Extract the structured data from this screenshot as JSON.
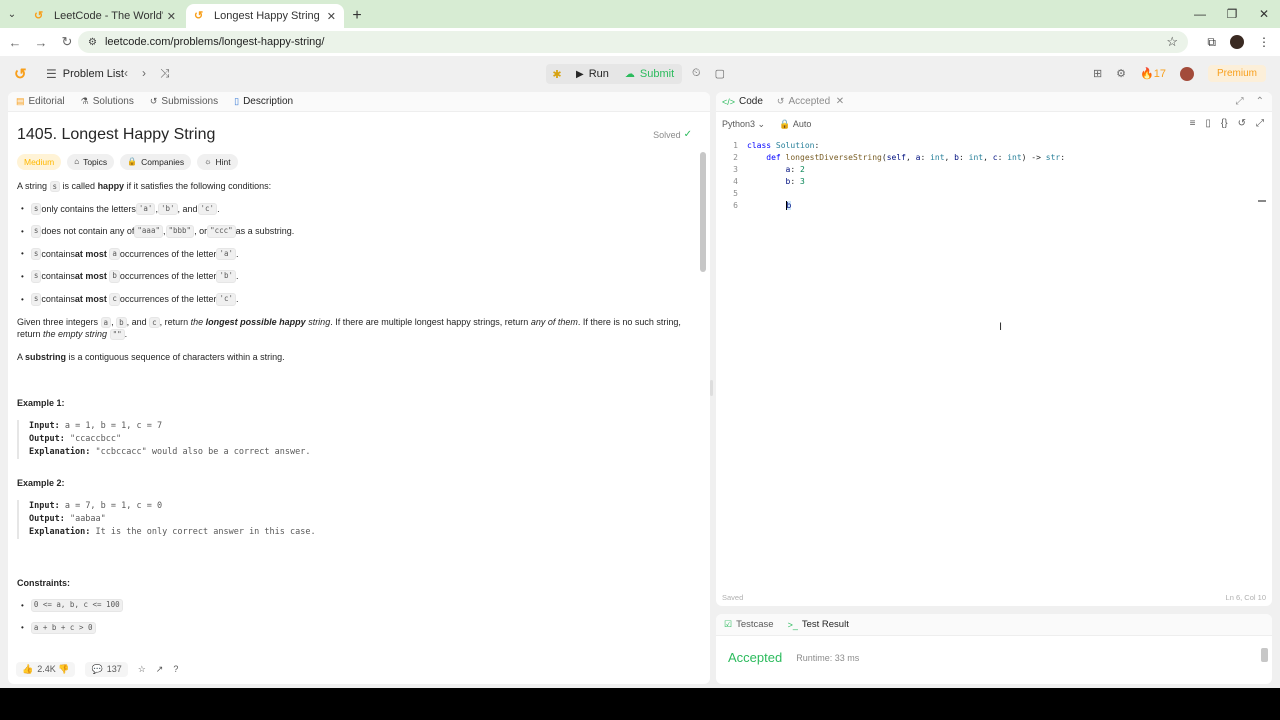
{
  "browser": {
    "tabs": [
      {
        "label": "LeetCode - The World's Leadin",
        "active": false
      },
      {
        "label": "Longest Happy String - LeetCo",
        "active": true
      }
    ],
    "url": "leetcode.com/problems/longest-happy-string/"
  },
  "topbar": {
    "problem_list": "Problem List",
    "run": "Run",
    "submit": "Submit",
    "streak": "17",
    "premium": "Premium"
  },
  "left_tabs": [
    "Editorial",
    "Solutions",
    "Submissions",
    "Description"
  ],
  "problem": {
    "title": "1405. Longest Happy String",
    "status": "Solved",
    "difficulty": "Medium",
    "chips": [
      "Topics",
      "Companies",
      "Hint"
    ],
    "intro_pre": "A string ",
    "intro_code": "s",
    "intro_mid": " is called ",
    "intro_bold": "happy",
    "intro_post": " if it satisfies the following conditions:",
    "conditions": [
      {
        "c1": "s",
        "t1": " only contains the letters ",
        "c2": "'a'",
        "t2": ", ",
        "c3": "'b'",
        "t3": ", and ",
        "c4": "'c'",
        "t4": "."
      },
      {
        "c1": "s",
        "t1": " does not contain any of ",
        "c2": "\"aaa\"",
        "t2": ", ",
        "c3": "\"bbb\"",
        "t3": ", or ",
        "c4": "\"ccc\"",
        "t4": " as a substring."
      },
      {
        "c1": "s",
        "t1": " contains ",
        "b": "at most",
        "c2": "a",
        "t2": " occurrences of the letter ",
        "c3": "'a'",
        "t3": "."
      },
      {
        "c1": "s",
        "t1": " contains ",
        "b": "at most",
        "c2": "b",
        "t2": " occurrences of the letter ",
        "c3": "'b'",
        "t3": "."
      },
      {
        "c1": "s",
        "t1": " contains ",
        "b": "at most",
        "c2": "c",
        "t2": " occurrences of the letter ",
        "c3": "'c'",
        "t3": "."
      }
    ],
    "given": {
      "p1": "Given three integers ",
      "a": "a",
      "sep1": ", ",
      "b": "b",
      "sep2": ", and ",
      "c": "c",
      "p2": ", return ",
      "i1": "the ",
      "bi": "longest possible happy",
      "i2": " string",
      "p3": ". If there are multiple longest happy strings, return ",
      "i3": "any of them",
      "p4": ". If there is no such string, return ",
      "i4": "the empty string",
      "p5": " ",
      "empty": "\"\"",
      "p6": "."
    },
    "substring_pre": "A ",
    "substring_bold": "substring",
    "substring_post": " is a contiguous sequence of characters within a string.",
    "examples": [
      {
        "title": "Example 1:",
        "input": "a = 1, b = 1, c = 7",
        "output": "\"ccaccbcc\"",
        "explanation": "\"ccbccacc\" would also be a correct answer."
      },
      {
        "title": "Example 2:",
        "input": "a = 7, b = 1, c = 0",
        "output": "\"aabaa\"",
        "explanation": "It is the only correct answer in this case."
      }
    ],
    "labels": {
      "input": "Input:",
      "output": "Output:",
      "explanation": "Explanation:"
    },
    "constraints_title": "Constraints:",
    "constraints": [
      "0 <= a, b, c <= 100",
      "a + b + c > 0"
    ]
  },
  "left_footer": {
    "likes": "2.4K",
    "comments": "137"
  },
  "code_panel": {
    "tab_code": "Code",
    "tab_accepted": "Accepted",
    "language": "Python3",
    "auto": "Auto",
    "lines": [
      {
        "n": "1",
        "code": "class Solution:"
      },
      {
        "n": "2",
        "code": "    def longestDiverseString(self, a: int, b: int, c: int) -> str:"
      },
      {
        "n": "3",
        "code": "        a: 2"
      },
      {
        "n": "4",
        "code": "        b: 3"
      },
      {
        "n": "5",
        "code": ""
      },
      {
        "n": "6",
        "code": "        b"
      }
    ],
    "saved": "Saved",
    "position": "Ln 6, Col 10"
  },
  "test_panel": {
    "tab_testcase": "Testcase",
    "tab_result": "Test Result",
    "result": "Accepted",
    "runtime": "Runtime: 33 ms"
  },
  "colors": {
    "accent": "#f89f1b",
    "success": "#2cbb5d",
    "link": "#3679d6"
  }
}
